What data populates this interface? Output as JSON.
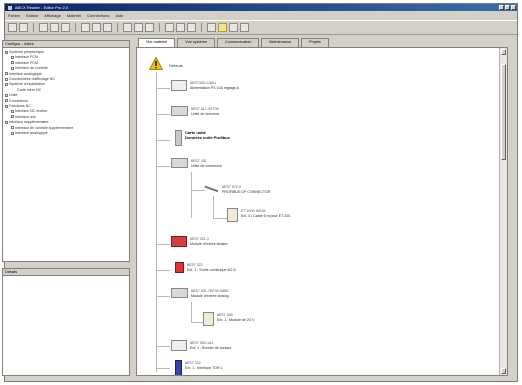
{
  "window": {
    "title": "ABCX Reader - Editor Pro 2.0"
  },
  "menu": [
    "Fichier",
    "Edition",
    "Affichage",
    "Materiel",
    "Connections",
    "Aide"
  ],
  "left_panel": {
    "header_tabs": [
      "Configur...",
      "Arbre"
    ],
    "tree": [
      {
        "level": 1,
        "label": "Systeme peripherique"
      },
      {
        "level": 2,
        "label": "Interface PCM"
      },
      {
        "level": 2,
        "label": "Interface PCM"
      },
      {
        "level": 2,
        "label": "Interface de contrôle"
      },
      {
        "level": 1,
        "label": "Interface analogique"
      },
      {
        "level": 1,
        "label": "Coordonnées d'affichage NC"
      },
      {
        "level": 1,
        "label": "Système d'exploitation"
      },
      {
        "level": 3,
        "label": "Carte mère NC"
      },
      {
        "level": 1,
        "label": "Unité"
      },
      {
        "level": 1,
        "label": "Connexions"
      },
      {
        "level": 1,
        "label": "Fonctions NC"
      },
      {
        "level": 2,
        "label": "Interface NC moteur"
      },
      {
        "level": 2,
        "label": "Interface axe"
      },
      {
        "level": 1,
        "label": "Interface supplémentaire"
      },
      {
        "level": 2,
        "label": "Interface de contrôle supplémentaire"
      },
      {
        "level": 2,
        "label": "Interface analogique"
      }
    ],
    "lower_header": "Détails"
  },
  "tabs": [
    "Vue matériel",
    "Vue système",
    "Communication",
    "Maintenance",
    "Projets"
  ],
  "diagram": {
    "root_label": "Défauts",
    "nodes": [
      {
        "id": "n1",
        "line1": "6ES7400-1JA01",
        "line2": "Alimentation PS 10A réglage A"
      },
      {
        "id": "n2",
        "line1": "6ES7 417-4XT05",
        "line2": "Unité de données"
      },
      {
        "id": "n3",
        "line1": "Carte unité",
        "line2": "Données unité Profibus",
        "bold": true
      },
      {
        "id": "n4",
        "line1": "6ES7 431",
        "line2": "Unité de connexion"
      },
      {
        "id": "n5",
        "line1": "6ES7 972-0",
        "line2": "PROFIBUS DP CONNECTOR"
      },
      {
        "id": "n6",
        "line1": "ET 200S IM151",
        "line2": "Ext. 5 / Cable 5 m pour ET 200"
      },
      {
        "id": "n7",
        "line1": "6ES7 321-1",
        "line2": "Module d'entrée binaire"
      },
      {
        "id": "n8",
        "line1": "6ES7 322",
        "line2": "Ext. 1 : Sortie numérique 8/2 A"
      },
      {
        "id": "n9",
        "line1": "6ES7 331-7KF02-0AB0",
        "line2": "Module d'entrée analog."
      },
      {
        "id": "n10",
        "line1": "6ES7 390",
        "line2": "Ext. 1 : Module de 24 V"
      },
      {
        "id": "n11",
        "line1": "6ES7 392-1AJ",
        "line2": "Ext. 1 : Bornier de contact"
      },
      {
        "id": "n12",
        "line1": "6ES7 332",
        "line2": "Ext. 1 : Interface TOR 1"
      }
    ]
  },
  "colors": {
    "title_bar": "#0a246a",
    "window_bg": "#d4d0c8",
    "accent_red": "#d24040",
    "accent_blue": "#3344aa",
    "warning": "#f5c400"
  }
}
